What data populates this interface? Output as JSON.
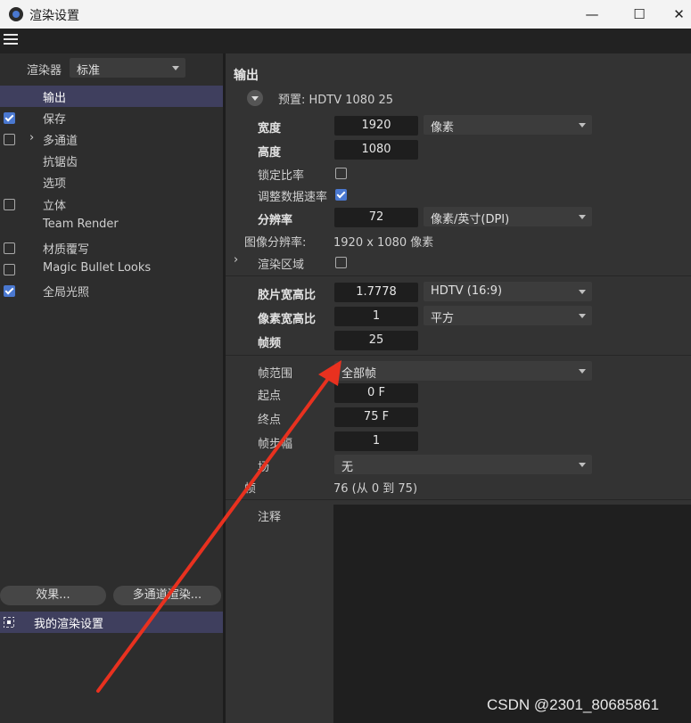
{
  "window": {
    "title": "渲染设置",
    "minimize": "—",
    "maximize": "☐",
    "close": "✕"
  },
  "left": {
    "renderer_label": "渲染器",
    "renderer_value": "标准",
    "items": [
      {
        "label": "输出",
        "checkbox": null,
        "selected": true
      },
      {
        "label": "保存",
        "checkbox": true
      },
      {
        "label": "多通道",
        "checkbox": false,
        "expander": "›"
      },
      {
        "label": "抗锯齿",
        "checkbox": null
      },
      {
        "label": "选项",
        "checkbox": null
      },
      {
        "label": "立体",
        "checkbox": false
      },
      {
        "label": "Team Render",
        "checkbox": null
      },
      {
        "label": "材质覆写",
        "checkbox": false
      },
      {
        "label": "Magic Bullet Looks",
        "checkbox": false
      },
      {
        "label": "全局光照",
        "checkbox": true
      }
    ],
    "effects_button": "效果...",
    "multipass_button": "多通道渲染...",
    "preset_name": "我的渲染设置"
  },
  "output": {
    "section_title": "输出",
    "preset": "预置: HDTV 1080 25",
    "width_label": "宽度",
    "width_value": "1920",
    "width_unit": "像素",
    "height_label": "高度",
    "height_value": "1080",
    "lock_ratio_label": "锁定比率",
    "lock_ratio_checked": false,
    "adapt_rate_label": "调整数据速率",
    "adapt_rate_checked": true,
    "resolution_label": "分辨率",
    "resolution_value": "72",
    "resolution_unit": "像素/英寸(DPI)",
    "image_res_label": "图像分辨率:",
    "image_res_value": "1920 x 1080 像素",
    "render_region_label": "渲染区域",
    "render_region_expander": "›",
    "render_region_checked": false,
    "film_aspect_label": "胶片宽高比",
    "film_aspect_value": "1.7778",
    "film_aspect_preset": "HDTV (16:9)",
    "pixel_aspect_label": "像素宽高比",
    "pixel_aspect_value": "1",
    "pixel_aspect_preset": "平方",
    "fps_label": "帧频",
    "fps_value": "25",
    "frame_range_label": "帧范围",
    "frame_range_value": "全部帧",
    "from_label": "起点",
    "from_value": "0 F",
    "to_label": "终点",
    "to_value": "75 F",
    "step_label": "帧步幅",
    "step_value": "1",
    "fields_label": "场",
    "fields_value": "无",
    "frames_label": "帧",
    "frames_value": "76 (从 0 到 75)",
    "notes_label": "注释"
  },
  "watermark": "CSDN @2301_80685861",
  "colors": {
    "accent": "#4a78d0",
    "selection": "#3f3f5e",
    "annotation_arrow": "#e8311f"
  }
}
